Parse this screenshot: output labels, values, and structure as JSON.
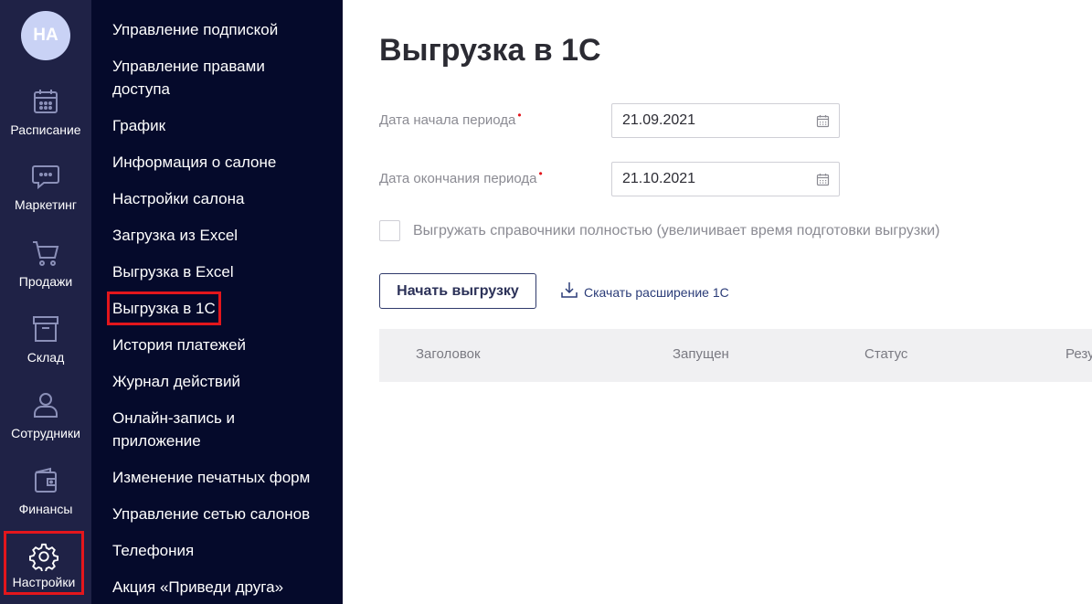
{
  "user": {
    "initials": "НА"
  },
  "rail": {
    "items": [
      {
        "label": "Расписание",
        "icon": "calendar-icon"
      },
      {
        "label": "Маркетинг",
        "icon": "chat-icon"
      },
      {
        "label": "Продажи",
        "icon": "cart-icon"
      },
      {
        "label": "Склад",
        "icon": "box-icon"
      },
      {
        "label": "Сотрудники",
        "icon": "user-icon"
      },
      {
        "label": "Финансы",
        "icon": "wallet-icon"
      },
      {
        "label": "Настройки",
        "icon": "gear-icon",
        "active": true
      }
    ]
  },
  "submenu": {
    "items": [
      "Управление подпиской",
      "Управление правами\nдоступа",
      "График",
      "Информация о салоне",
      "Настройки салона",
      "Загрузка из Excel",
      "Выгрузка в Excel",
      "Выгрузка в 1С",
      "История платежей",
      "Журнал действий",
      "Онлайн-запись и\nприложение",
      "Изменение печатных форм",
      "Управление сетью салонов",
      "Телефония",
      "Акция «Приведи друга»"
    ],
    "active_index": 7
  },
  "main": {
    "title": "Выгрузка в 1С",
    "start_date": {
      "label": "Дата начала периода",
      "required_mark": "•",
      "value": "21.09.2021"
    },
    "end_date": {
      "label": "Дата окончания периода",
      "required_mark": "•",
      "value": "21.10.2021"
    },
    "full_export_checkbox": {
      "label": "Выгружать справочники полностью (увеличивает время подготовки выгрузки)",
      "checked": false
    },
    "start_button": "Начать выгрузку",
    "download_link": "Скачать расширение 1С",
    "table": {
      "columns": [
        "Заголовок",
        "Запущен",
        "Статус",
        "Резу"
      ]
    }
  },
  "colors": {
    "rail_bg": "#1f2246",
    "submenu_bg": "#050a2b",
    "highlight": "#e3161c",
    "accent": "#2f3a6b"
  }
}
